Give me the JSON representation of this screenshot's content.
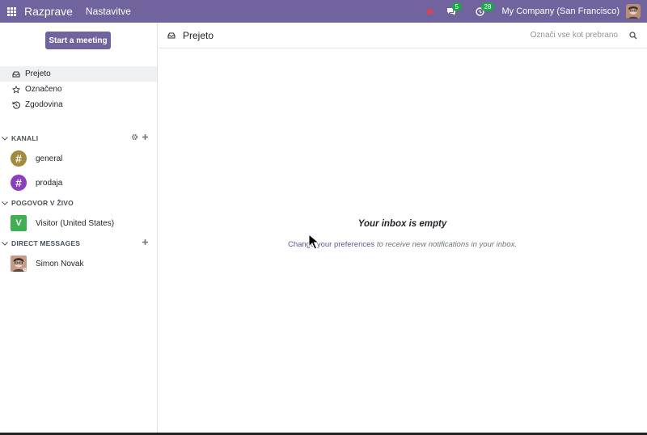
{
  "navbar": {
    "app_name": "Razprave",
    "menu_settings": "Nastavitve",
    "messages_count": "5",
    "activities_count": "28",
    "company": "My Company (San Francisco)",
    "accent": "#71639e",
    "badge_color": "#1fa54b"
  },
  "sidebar": {
    "start_meeting": "Start a meeting",
    "items": [
      {
        "label": "Prejeto",
        "icon": "inbox-icon"
      },
      {
        "label": "Označeno",
        "icon": "star-icon"
      },
      {
        "label": "Zgodovina",
        "icon": "history-icon"
      }
    ],
    "channels_header": "KANALI",
    "channels": [
      {
        "label": "general",
        "color": "#a28a3e"
      },
      {
        "label": "prodaja",
        "color": "#8a3fbd"
      }
    ],
    "livechat_header": "POGOVOR V ŽIVO",
    "livechats": [
      {
        "label": "Visitor (United States)",
        "initial": "V"
      }
    ],
    "dm_header": "DIRECT MESSAGES",
    "dms": [
      {
        "label": "Simon Novak"
      }
    ]
  },
  "main": {
    "title": "Prejeto",
    "mark_all_read": "Označi vse kot prebrano",
    "empty_title": "Your inbox is empty",
    "empty_link": "Change your preferences",
    "empty_text": "to receive new notifications in your inbox."
  }
}
